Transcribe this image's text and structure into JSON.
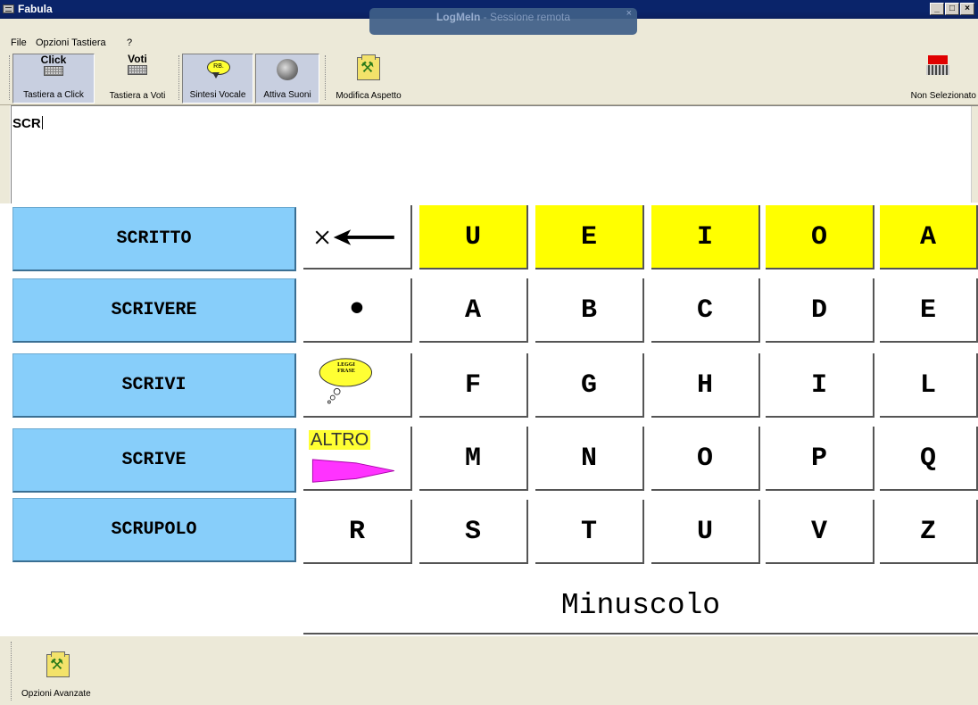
{
  "window": {
    "title": "Fabula",
    "controls": [
      "_",
      "□",
      "×"
    ]
  },
  "remote_overlay": {
    "label": "LogMeIn",
    "sublabel": "- Sessione remota",
    "close": "×"
  },
  "menu": {
    "items": [
      "File",
      "Opzioni Tastiera",
      "?"
    ]
  },
  "toolbar": {
    "click": {
      "caption": "Click",
      "label": "Tastiera a Click"
    },
    "voti": {
      "caption": "Voti",
      "label": "Tastiera a Voti"
    },
    "sintesi": {
      "label": "Sintesi Vocale"
    },
    "suoni": {
      "label": "Attiva Suoni"
    },
    "aspetto": {
      "label": "Modifica Aspetto"
    },
    "selezione": {
      "label": "Non Selezionato"
    }
  },
  "editor": {
    "text": "SCR"
  },
  "suggestions": [
    "SCRITTO",
    "SCRIVERE",
    "SCRIVI",
    "SCRIVE",
    "SCRUPOLO"
  ],
  "keys": {
    "row1": [
      "U",
      "E",
      "I",
      "O",
      "A"
    ],
    "row2": [
      "A",
      "B",
      "C",
      "D",
      "E"
    ],
    "row3": [
      "F",
      "G",
      "H",
      "I",
      "L"
    ],
    "row4": [
      "M",
      "N",
      "O",
      "P",
      "Q"
    ],
    "row5": [
      "R",
      "S",
      "T",
      "U",
      "V",
      "Z"
    ],
    "dot": "•",
    "leggi_frase": "LEGGI FRASE",
    "altro": "ALTRO"
  },
  "case_toggle": "Minuscolo",
  "bottom": {
    "advanced": "Opzioni Avanzate"
  },
  "colors": {
    "suggestion_bg": "#87cefa",
    "vowel_key_bg": "#ffff00",
    "altro_arrow": "#ff33ff"
  }
}
